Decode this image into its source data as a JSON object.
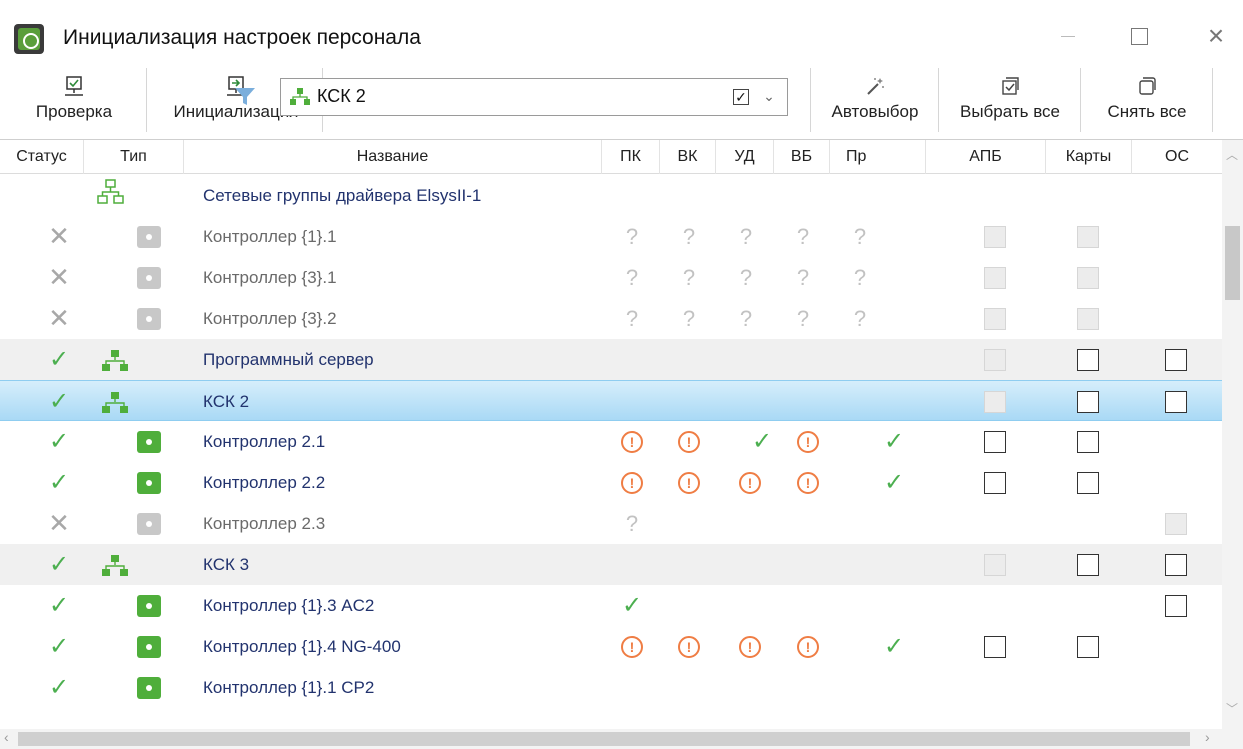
{
  "window": {
    "title": "Инициализация настроек персонала"
  },
  "toolbar": {
    "check_label": "Проверка",
    "init_label": "Инициализация",
    "filter_value": "КСК 2",
    "filter_checked": "✓",
    "auto_label": "Автовыбор",
    "select_all_label": "Выбрать все",
    "clear_all_label": "Снять все"
  },
  "columns": [
    "Статус",
    "Тип",
    "Название",
    "ПК",
    "ВК",
    "УД",
    "ВБ",
    "Пр",
    "АПБ",
    "Карты",
    "ОС"
  ],
  "rows": [
    {
      "name": "Сетевые группы драйвера ElsysII-1"
    },
    {
      "name": "Контроллер {1}.1"
    },
    {
      "name": "Контроллер {3}.1"
    },
    {
      "name": "Контроллер {3}.2"
    },
    {
      "name": "Программный сервер"
    },
    {
      "name": "КСК 2"
    },
    {
      "name": "Контроллер 2.1"
    },
    {
      "name": "Контроллер 2.2"
    },
    {
      "name": "Контроллер 2.3"
    },
    {
      "name": "КСК 3"
    },
    {
      "name": "Контроллер {1}.3 AC2"
    },
    {
      "name": "Контроллер {1}.4 NG-400"
    },
    {
      "name": "Контроллер {1}.1 CP2"
    }
  ],
  "colors": {
    "ok": "#4caf50",
    "warn": "#ef7d44",
    "selected": "#a9d9f5",
    "link": "#22336e"
  }
}
